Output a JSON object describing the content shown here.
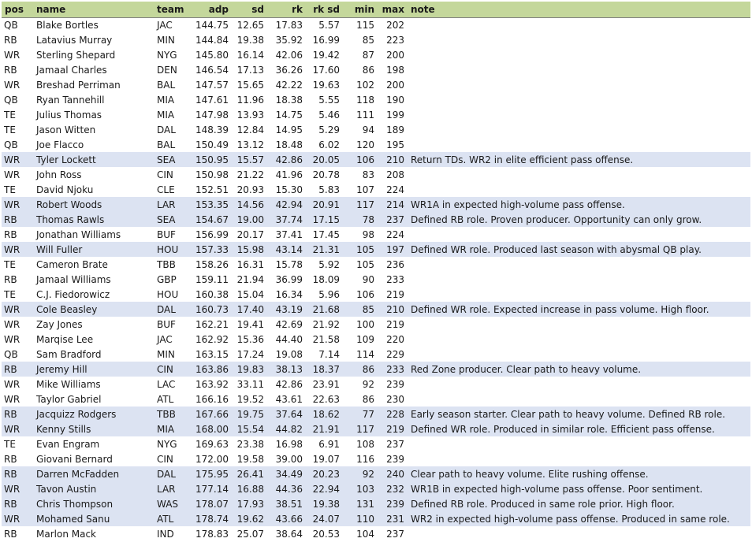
{
  "columns": [
    {
      "key": "pos",
      "label": "pos",
      "align": "l"
    },
    {
      "key": "name",
      "label": "name",
      "align": "l"
    },
    {
      "key": "team",
      "label": "team",
      "align": "l"
    },
    {
      "key": "adp",
      "label": "adp",
      "align": "r"
    },
    {
      "key": "sd",
      "label": "sd",
      "align": "r"
    },
    {
      "key": "rk",
      "label": "rk",
      "align": "r"
    },
    {
      "key": "rk_sd",
      "label": "rk sd",
      "align": "r"
    },
    {
      "key": "min",
      "label": "min",
      "align": "r"
    },
    {
      "key": "max",
      "label": "max",
      "align": "r"
    },
    {
      "key": "note",
      "label": "note",
      "align": "l"
    }
  ],
  "highlight_color": "#dce3f2",
  "header_color": "#c4d79b",
  "rows": [
    {
      "pos": "QB",
      "name": "Blake Bortles",
      "team": "JAC",
      "adp": "144.75",
      "sd": "12.65",
      "rk": "17.83",
      "rk_sd": "5.57",
      "min": "115",
      "max": "202",
      "note": "",
      "highlight": false
    },
    {
      "pos": "RB",
      "name": "Latavius Murray",
      "team": "MIN",
      "adp": "144.84",
      "sd": "19.38",
      "rk": "35.92",
      "rk_sd": "16.99",
      "min": "85",
      "max": "223",
      "note": "",
      "highlight": false
    },
    {
      "pos": "WR",
      "name": "Sterling Shepard",
      "team": "NYG",
      "adp": "145.80",
      "sd": "16.14",
      "rk": "42.06",
      "rk_sd": "19.42",
      "min": "87",
      "max": "200",
      "note": "",
      "highlight": false
    },
    {
      "pos": "RB",
      "name": "Jamaal Charles",
      "team": "DEN",
      "adp": "146.54",
      "sd": "17.13",
      "rk": "36.26",
      "rk_sd": "17.60",
      "min": "86",
      "max": "198",
      "note": "",
      "highlight": false
    },
    {
      "pos": "WR",
      "name": "Breshad Perriman",
      "team": "BAL",
      "adp": "147.57",
      "sd": "15.65",
      "rk": "42.22",
      "rk_sd": "19.63",
      "min": "102",
      "max": "200",
      "note": "",
      "highlight": false
    },
    {
      "pos": "QB",
      "name": "Ryan Tannehill",
      "team": "MIA",
      "adp": "147.61",
      "sd": "11.96",
      "rk": "18.38",
      "rk_sd": "5.55",
      "min": "118",
      "max": "190",
      "note": "",
      "highlight": false
    },
    {
      "pos": "TE",
      "name": "Julius Thomas",
      "team": "MIA",
      "adp": "147.98",
      "sd": "13.93",
      "rk": "14.75",
      "rk_sd": "5.46",
      "min": "111",
      "max": "199",
      "note": "",
      "highlight": false
    },
    {
      "pos": "TE",
      "name": "Jason Witten",
      "team": "DAL",
      "adp": "148.39",
      "sd": "12.84",
      "rk": "14.95",
      "rk_sd": "5.29",
      "min": "94",
      "max": "189",
      "note": "",
      "highlight": false
    },
    {
      "pos": "QB",
      "name": "Joe Flacco",
      "team": "BAL",
      "adp": "150.49",
      "sd": "13.12",
      "rk": "18.48",
      "rk_sd": "6.02",
      "min": "120",
      "max": "195",
      "note": "",
      "highlight": false
    },
    {
      "pos": "WR",
      "name": "Tyler Lockett",
      "team": "SEA",
      "adp": "150.95",
      "sd": "15.57",
      "rk": "42.86",
      "rk_sd": "20.05",
      "min": "106",
      "max": "210",
      "note": "Return TDs. WR2 in elite efficient pass offense.",
      "highlight": true
    },
    {
      "pos": "WR",
      "name": "John Ross",
      "team": "CIN",
      "adp": "150.98",
      "sd": "21.22",
      "rk": "41.96",
      "rk_sd": "20.78",
      "min": "83",
      "max": "208",
      "note": "",
      "highlight": false
    },
    {
      "pos": "TE",
      "name": "David Njoku",
      "team": "CLE",
      "adp": "152.51",
      "sd": "20.93",
      "rk": "15.30",
      "rk_sd": "5.83",
      "min": "107",
      "max": "224",
      "note": "",
      "highlight": false
    },
    {
      "pos": "WR",
      "name": "Robert Woods",
      "team": "LAR",
      "adp": "153.35",
      "sd": "14.56",
      "rk": "42.94",
      "rk_sd": "20.91",
      "min": "117",
      "max": "214",
      "note": "WR1A in expected high-volume pass offense.",
      "highlight": true
    },
    {
      "pos": "RB",
      "name": "Thomas Rawls",
      "team": "SEA",
      "adp": "154.67",
      "sd": "19.00",
      "rk": "37.74",
      "rk_sd": "17.15",
      "min": "78",
      "max": "237",
      "note": "Defined RB role. Proven producer. Opportunity can only grow.",
      "highlight": true
    },
    {
      "pos": "RB",
      "name": "Jonathan Williams",
      "team": "BUF",
      "adp": "156.99",
      "sd": "20.17",
      "rk": "37.41",
      "rk_sd": "17.45",
      "min": "98",
      "max": "224",
      "note": "",
      "highlight": false
    },
    {
      "pos": "WR",
      "name": "Will Fuller",
      "team": "HOU",
      "adp": "157.33",
      "sd": "15.98",
      "rk": "43.14",
      "rk_sd": "21.31",
      "min": "105",
      "max": "197",
      "note": "Defined WR role. Produced last season with abysmal QB play.",
      "highlight": true
    },
    {
      "pos": "TE",
      "name": "Cameron Brate",
      "team": "TBB",
      "adp": "158.26",
      "sd": "16.31",
      "rk": "15.78",
      "rk_sd": "5.92",
      "min": "105",
      "max": "236",
      "note": "",
      "highlight": false
    },
    {
      "pos": "RB",
      "name": "Jamaal Williams",
      "team": "GBP",
      "adp": "159.11",
      "sd": "21.94",
      "rk": "36.99",
      "rk_sd": "18.09",
      "min": "90",
      "max": "233",
      "note": "",
      "highlight": false
    },
    {
      "pos": "TE",
      "name": "C.J. Fiedorowicz",
      "team": "HOU",
      "adp": "160.38",
      "sd": "15.04",
      "rk": "16.34",
      "rk_sd": "5.96",
      "min": "106",
      "max": "219",
      "note": "",
      "highlight": false
    },
    {
      "pos": "WR",
      "name": "Cole Beasley",
      "team": "DAL",
      "adp": "160.73",
      "sd": "17.40",
      "rk": "43.19",
      "rk_sd": "21.68",
      "min": "85",
      "max": "210",
      "note": "Defined WR role. Expected increase in pass volume. High floor.",
      "highlight": true
    },
    {
      "pos": "WR",
      "name": "Zay Jones",
      "team": "BUF",
      "adp": "162.21",
      "sd": "19.41",
      "rk": "42.69",
      "rk_sd": "21.92",
      "min": "100",
      "max": "219",
      "note": "",
      "highlight": false
    },
    {
      "pos": "WR",
      "name": "Marqise Lee",
      "team": "JAC",
      "adp": "162.92",
      "sd": "15.36",
      "rk": "44.40",
      "rk_sd": "21.58",
      "min": "109",
      "max": "220",
      "note": "",
      "highlight": false
    },
    {
      "pos": "QB",
      "name": "Sam Bradford",
      "team": "MIN",
      "adp": "163.15",
      "sd": "17.24",
      "rk": "19.08",
      "rk_sd": "7.14",
      "min": "114",
      "max": "229",
      "note": "",
      "highlight": false
    },
    {
      "pos": "RB",
      "name": "Jeremy Hill",
      "team": "CIN",
      "adp": "163.86",
      "sd": "19.83",
      "rk": "38.13",
      "rk_sd": "18.37",
      "min": "86",
      "max": "233",
      "note": "Red Zone producer. Clear path to heavy volume.",
      "highlight": true
    },
    {
      "pos": "WR",
      "name": "Mike Williams",
      "team": "LAC",
      "adp": "163.92",
      "sd": "33.11",
      "rk": "42.86",
      "rk_sd": "23.91",
      "min": "92",
      "max": "239",
      "note": "",
      "highlight": false
    },
    {
      "pos": "WR",
      "name": "Taylor Gabriel",
      "team": "ATL",
      "adp": "166.16",
      "sd": "19.52",
      "rk": "43.61",
      "rk_sd": "22.63",
      "min": "86",
      "max": "230",
      "note": "",
      "highlight": false
    },
    {
      "pos": "RB",
      "name": "Jacquizz Rodgers",
      "team": "TBB",
      "adp": "167.66",
      "sd": "19.75",
      "rk": "37.64",
      "rk_sd": "18.62",
      "min": "77",
      "max": "228",
      "note": "Early season starter. Clear path to heavy volume. Defined RB role.",
      "highlight": true
    },
    {
      "pos": "WR",
      "name": "Kenny Stills",
      "team": "MIA",
      "adp": "168.00",
      "sd": "15.54",
      "rk": "44.82",
      "rk_sd": "21.91",
      "min": "117",
      "max": "219",
      "note": "Defined WR role. Produced in similar role. Efficient pass offense.",
      "highlight": true
    },
    {
      "pos": "TE",
      "name": "Evan Engram",
      "team": "NYG",
      "adp": "169.63",
      "sd": "23.38",
      "rk": "16.98",
      "rk_sd": "6.91",
      "min": "108",
      "max": "237",
      "note": "",
      "highlight": false
    },
    {
      "pos": "RB",
      "name": "Giovani Bernard",
      "team": "CIN",
      "adp": "172.00",
      "sd": "19.58",
      "rk": "39.00",
      "rk_sd": "19.07",
      "min": "116",
      "max": "239",
      "note": "",
      "highlight": false
    },
    {
      "pos": "RB",
      "name": "Darren McFadden",
      "team": "DAL",
      "adp": "175.95",
      "sd": "26.41",
      "rk": "34.49",
      "rk_sd": "20.23",
      "min": "92",
      "max": "240",
      "note": "Clear path to heavy volume. Elite rushing offense.",
      "highlight": true
    },
    {
      "pos": "WR",
      "name": "Tavon Austin",
      "team": "LAR",
      "adp": "177.14",
      "sd": "16.88",
      "rk": "44.36",
      "rk_sd": "22.94",
      "min": "103",
      "max": "232",
      "note": "WR1B in expected high-volume pass offense. Poor sentiment.",
      "highlight": true
    },
    {
      "pos": "RB",
      "name": "Chris Thompson",
      "team": "WAS",
      "adp": "178.07",
      "sd": "17.93",
      "rk": "38.51",
      "rk_sd": "19.38",
      "min": "131",
      "max": "239",
      "note": "Defined RB role. Produced in same role prior. High floor.",
      "highlight": true
    },
    {
      "pos": "WR",
      "name": "Mohamed Sanu",
      "team": "ATL",
      "adp": "178.74",
      "sd": "19.62",
      "rk": "43.66",
      "rk_sd": "24.07",
      "min": "110",
      "max": "231",
      "note": "WR2 in expected high-volume pass offense. Produced in same role.",
      "highlight": true
    },
    {
      "pos": "RB",
      "name": "Marlon Mack",
      "team": "IND",
      "adp": "178.83",
      "sd": "25.07",
      "rk": "38.64",
      "rk_sd": "20.53",
      "min": "104",
      "max": "237",
      "note": "",
      "highlight": false
    }
  ]
}
